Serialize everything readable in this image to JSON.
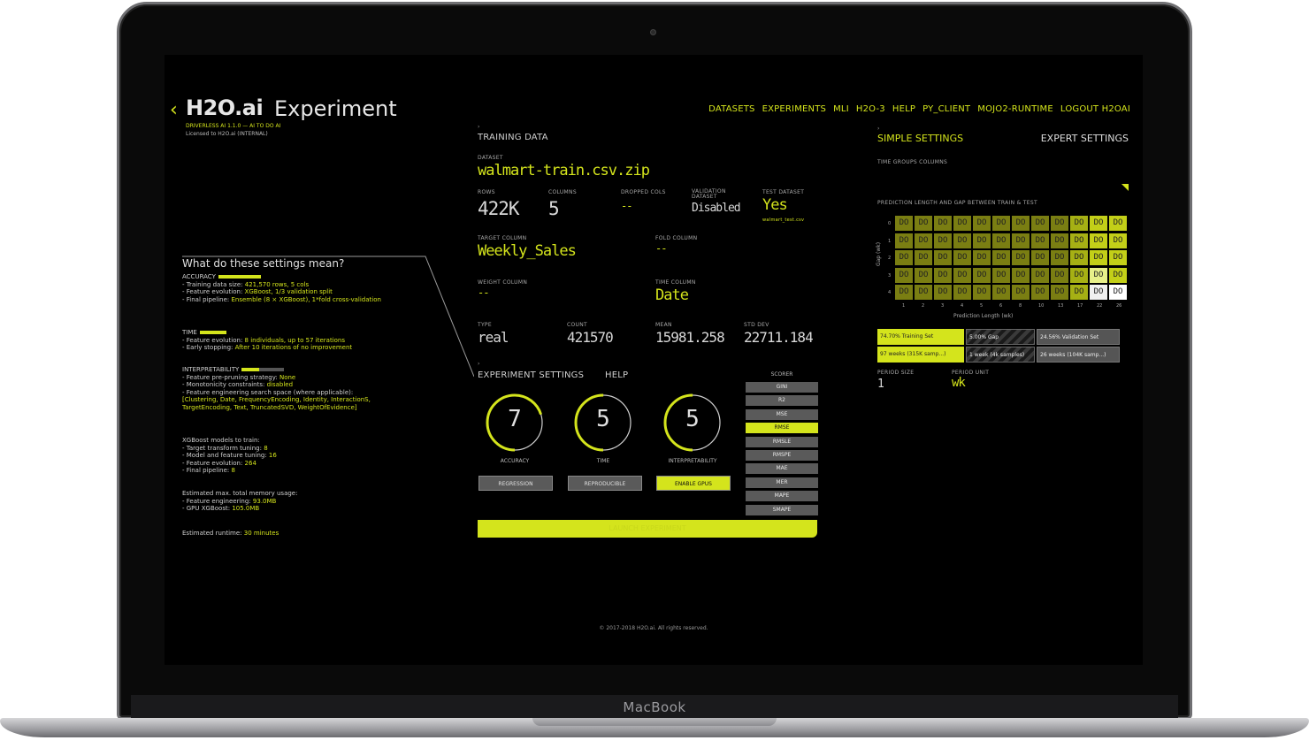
{
  "device": {
    "label": "MacBook"
  },
  "header": {
    "brand": "H2O.ai",
    "title": "Experiment",
    "version": "DRIVERLESS AI 1.1.0 — AI TO DO AI",
    "license": "Licensed to H2O.ai (INTERNAL)"
  },
  "nav": [
    "DATASETS",
    "EXPERIMENTS",
    "MLI",
    "H2O-3",
    "HELP",
    "PY_CLIENT",
    "MOJO2-RUNTIME",
    "LOGOUT H2OAI"
  ],
  "help": {
    "title": "What do these settings mean?",
    "accuracy": {
      "label": "ACCURACY",
      "lines": [
        [
          "- Training data size: ",
          "421,570 rows, 5 cols"
        ],
        [
          "- Feature evolution: ",
          "XGBoost, 1/3 validation split"
        ],
        [
          "- Final pipeline: ",
          "Ensemble (8 × XGBoost), 1*fold cross-validation"
        ]
      ]
    },
    "time": {
      "label": "TIME",
      "lines": [
        [
          "- Feature evolution: ",
          "8 individuals, up to 57 iterations"
        ],
        [
          "- Early stopping: ",
          "After 10 iterations of no improvement"
        ]
      ]
    },
    "interpretability": {
      "label": "INTERPRETABILITY",
      "lines": [
        [
          "- Feature pre-pruning strategy: ",
          "None"
        ],
        [
          "- Monotonicity constraints: ",
          "disabled"
        ],
        [
          "- Feature engineering search space (where applicable): ",
          ""
        ],
        [
          "",
          "[Clustering, Date, FrequencyEncoding, Identity, InteractionS, TargetEncoding, Text, TruncatedSVD, WeightOfEvidence]"
        ]
      ]
    },
    "models": {
      "label": "XGBoost models to train:",
      "lines": [
        [
          "- Target transform tuning: ",
          "8"
        ],
        [
          "- Model and feature tuning: ",
          "16"
        ],
        [
          "- Feature evolution: ",
          "264"
        ],
        [
          "- Final pipeline: ",
          "8"
        ]
      ]
    },
    "memory": {
      "label": "Estimated max. total memory usage:",
      "lines": [
        [
          "- Feature engineering: ",
          "93.0MB"
        ],
        [
          "- GPU XGBoost: ",
          "105.0MB"
        ]
      ]
    },
    "runtime": [
      "Estimated runtime: ",
      "30 minutes"
    ]
  },
  "training": {
    "section": "TRAINING DATA",
    "dataset_label": "DATASET",
    "dataset": "walmart-train.csv.zip",
    "rows_label": "ROWS",
    "rows": "422K",
    "cols_label": "COLUMNS",
    "cols": "5",
    "dropped_label": "DROPPED COLS",
    "dropped": "--",
    "validation_label": "VALIDATION DATASET",
    "validation": "Disabled",
    "test_label": "TEST DATASET",
    "test": "Yes",
    "test_name": "walmart_test.csv",
    "target_label": "TARGET COLUMN",
    "target": "Weekly_Sales",
    "fold_label": "FOLD COLUMN",
    "fold": "--",
    "weight_label": "WEIGHT COLUMN",
    "weight": "--",
    "timecol_label": "TIME COLUMN",
    "timecol": "Date",
    "type_label": "TYPE",
    "type": "real",
    "count_label": "COUNT",
    "count": "421570",
    "mean_label": "MEAN",
    "mean": "15981.258",
    "std_label": "STD DEV",
    "std": "22711.184"
  },
  "settings": {
    "section": "EXPERIMENT SETTINGS",
    "help": "HELP",
    "accuracy": {
      "label": "ACCURACY",
      "value": 7
    },
    "time": {
      "label": "TIME",
      "value": 5
    },
    "interpretability": {
      "label": "INTERPRETABILITY",
      "value": 5
    },
    "toggles": [
      "REGRESSION",
      "REPRODUCIBLE",
      "ENABLE GPUS"
    ],
    "scorer_label": "SCORER",
    "scorers": [
      "GINI",
      "R2",
      "MSE",
      "RMSE",
      "RMSLE",
      "RMSPE",
      "MAE",
      "MER",
      "MAPE",
      "SMAPE"
    ],
    "scorer_selected": "RMSE",
    "launch": "LAUNCH EXPERIMENT"
  },
  "right": {
    "simple": "SIMPLE SETTINGS",
    "expert": "EXPERT SETTINGS",
    "time_groups": "TIME GROUPS COLUMNS",
    "heat_title": "PREDICTION LENGTH AND GAP BETWEEN TRAIN & TEST",
    "x_axis": "Prediction Length (wk)",
    "y_axis": "Gap (wk)",
    "x_ticks": [
      "1",
      "2",
      "3",
      "4",
      "5",
      "6",
      "8",
      "10",
      "13",
      "17",
      "22",
      "26"
    ],
    "y_ticks": [
      "0",
      "1",
      "2",
      "3",
      "4"
    ],
    "cell_glyph": "DO",
    "splits": [
      [
        "74.70% Training Set",
        "5.00% Gap",
        "24.56% Validation Set"
      ],
      [
        "97 weeks (315K samp...)",
        "1 week (4k samples)",
        "26 weeks (104K samp...)"
      ]
    ],
    "period_size_label": "PERIOD SIZE",
    "period_size": "1",
    "period_unit_label": "PERIOD UNIT",
    "period_unit": "wk"
  },
  "footer": "© 2017-2018 H2O.ai. All rights reserved.",
  "colors": {
    "accent": "#d4e41c",
    "screen": "#000000"
  }
}
